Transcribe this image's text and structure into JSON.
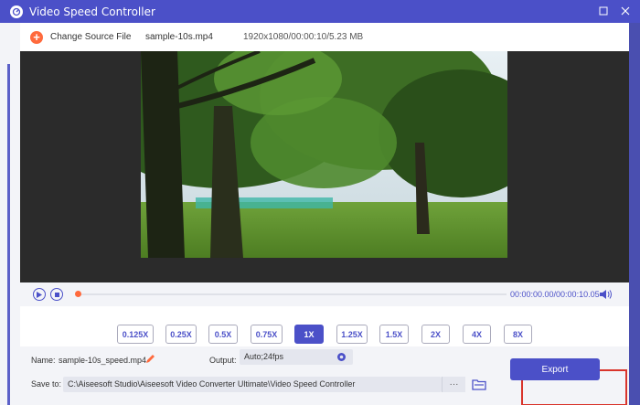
{
  "window": {
    "title": "Video Speed Controller",
    "min_icon": "minimize-icon",
    "close_icon": "close-icon"
  },
  "toolbar": {
    "change_source_label": "Change Source File",
    "file_name": "sample-10s.mp4",
    "file_info": "1920x1080/00:00:10/5.23 MB"
  },
  "player": {
    "timecode": "00:00:00.00/00:00:10.05",
    "progress": 0
  },
  "speeds": [
    {
      "label": "0.125X",
      "active": false
    },
    {
      "label": "0.25X",
      "active": false
    },
    {
      "label": "0.5X",
      "active": false
    },
    {
      "label": "0.75X",
      "active": false
    },
    {
      "label": "1X",
      "active": true
    },
    {
      "label": "1.25X",
      "active": false
    },
    {
      "label": "1.5X",
      "active": false
    },
    {
      "label": "2X",
      "active": false
    },
    {
      "label": "4X",
      "active": false
    },
    {
      "label": "8X",
      "active": false
    }
  ],
  "output": {
    "name_label": "Name:",
    "name_value": "sample-10s_speed.mp4",
    "output_label": "Output:",
    "output_value": "Auto;24fps",
    "save_label": "Save to:",
    "save_path": "C:\\Aiseesoft Studio\\Aiseesoft Video Converter Ultimate\\Video Speed Controller",
    "more_label": "···",
    "export_label": "Export"
  },
  "colors": {
    "accent": "#4b50c8",
    "highlight": "#d9342b",
    "orange": "#ff6a3d"
  }
}
